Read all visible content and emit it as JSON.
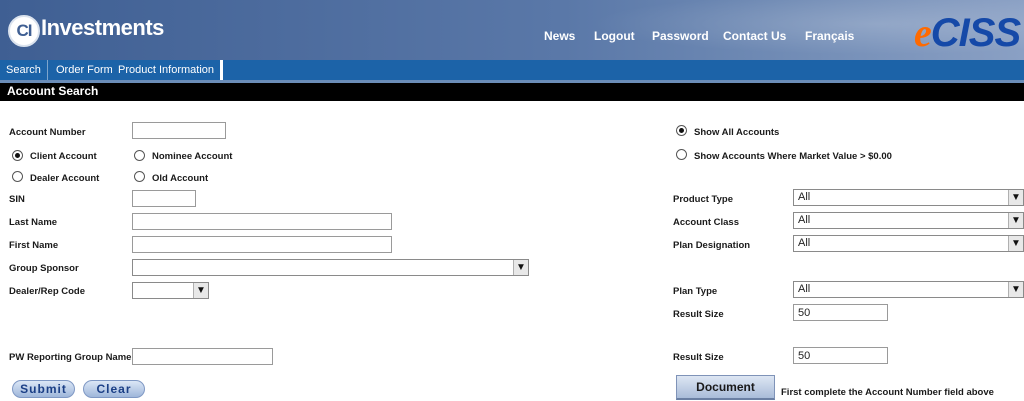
{
  "header": {
    "logo_mark": "CI",
    "logo_text": "Investments",
    "nav": [
      "News",
      "Logout",
      "Password",
      "Contact Us",
      "Français"
    ],
    "brand_e": "e",
    "brand_rest": "CISS"
  },
  "tabs": [
    "Search",
    "Order Form",
    "Product Information"
  ],
  "page_title": "Account Search",
  "left": {
    "account_number": {
      "label": "Account Number",
      "value": ""
    },
    "radio_options": [
      {
        "label": "Client Account",
        "checked": true
      },
      {
        "label": "Nominee Account",
        "checked": false
      },
      {
        "label": "Dealer Account",
        "checked": false
      },
      {
        "label": "Old Account",
        "checked": false
      }
    ],
    "sin": {
      "label": "SIN",
      "value": ""
    },
    "last_name": {
      "label": "Last Name",
      "value": ""
    },
    "first_name": {
      "label": "First Name",
      "value": ""
    },
    "group_sponsor": {
      "label": "Group Sponsor",
      "value": ""
    },
    "dealer_rep": {
      "label": "Dealer/Rep Code",
      "value": ""
    },
    "pw_group": {
      "label": "PW Reporting Group Name",
      "value": ""
    },
    "submit_label": "Submit",
    "clear_label": "Clear"
  },
  "right": {
    "show_options": [
      {
        "label": "Show All Accounts",
        "checked": true
      },
      {
        "label": "Show Accounts Where Market Value > $0.00",
        "checked": false
      }
    ],
    "product_type": {
      "label": "Product Type",
      "value": "All"
    },
    "account_class": {
      "label": "Account Class",
      "value": "All"
    },
    "plan_designation": {
      "label": "Plan Designation",
      "value": "All"
    },
    "plan_type": {
      "label": "Plan Type",
      "value": "All"
    },
    "result_size_1": {
      "label": "Result Size",
      "value": "50"
    },
    "result_size_2": {
      "label": "Result Size",
      "value": "50"
    },
    "doc_centre_label": "Document Centre",
    "doc_centre_note": "First complete the Account Number field above"
  },
  "icons": {
    "dropdown": "chevron-down-icon"
  },
  "colors": {
    "banner": "#3f5f93",
    "tabbar": "#1c63a8",
    "titlebar": "#000000",
    "brand_orange": "#ff6a00",
    "brand_blue": "#1549a8"
  }
}
